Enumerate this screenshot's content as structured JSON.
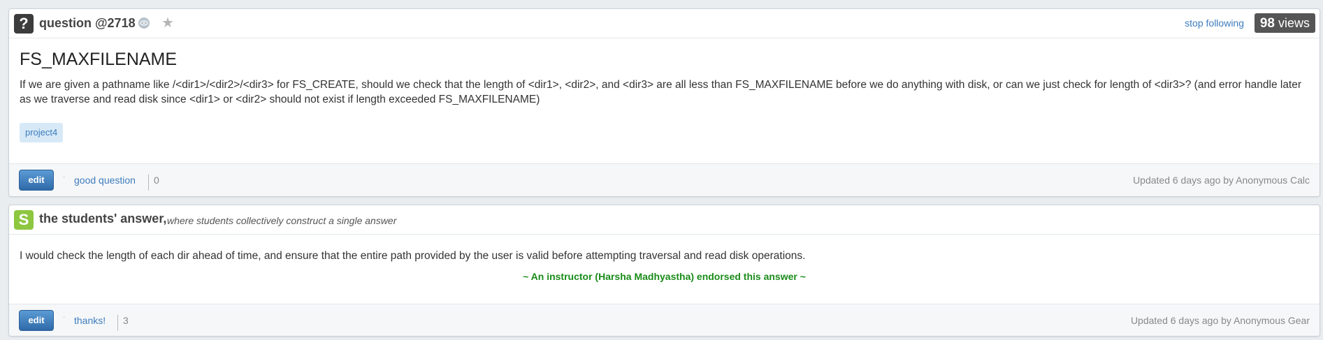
{
  "question": {
    "type_icon": "question-icon",
    "badge_glyph": "?",
    "number_label": "question @2718",
    "stop_following": "stop following",
    "views_count": "98",
    "views_label": "views",
    "title": "FS_MAXFILENAME",
    "body": "If we are given a pathname like /<dir1>/<dir2>/<dir3> for FS_CREATE, should we check that the length of <dir1>, <dir2>, and <dir3> are all less than FS_MAXFILENAME before we do anything with disk, or can we just check for length of <dir3>? (and error handle later as we traverse and read disk since <dir1> or <dir2> should not exist if length exceeded FS_MAXFILENAME)",
    "tag": "project4",
    "edit_label": "edit",
    "feedback_label": "good question",
    "feedback_count": "0",
    "updated": "Updated 6 days ago by Anonymous Calc"
  },
  "answer": {
    "badge_glyph": "S",
    "title": "the students' answer,",
    "subtitle": "where students collectively construct a single answer",
    "body": "I would check the length of each dir ahead of time, and ensure that the entire path provided by the user is valid before attempting traversal and read disk operations.",
    "endorsement": "~ An instructor (Harsha Madhyastha) endorsed this answer  ~",
    "edit_label": "edit",
    "feedback_label": "thanks!",
    "feedback_count": "3",
    "updated": "Updated 6 days ago by Anonymous Gear"
  },
  "colors": {
    "link": "#3d7cbd",
    "student_badge": "#8dc63f",
    "endorse": "#1a8c1a"
  }
}
